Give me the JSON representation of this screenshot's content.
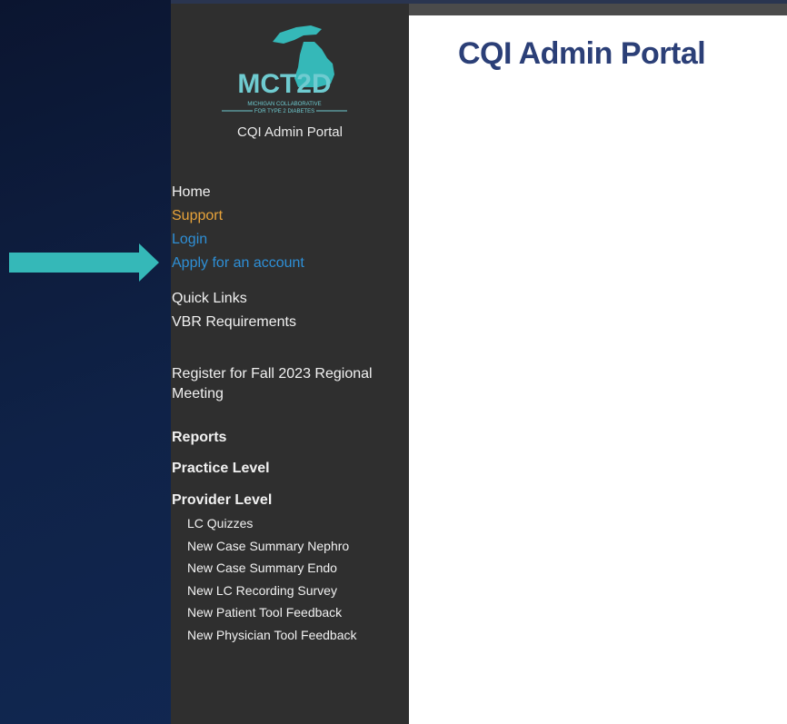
{
  "app": {
    "title": "CQI Admin Portal",
    "logo_text": "MCT2D",
    "logo_sub1": "MICHIGAN COLLABORATIVE",
    "logo_sub2": "FOR TYPE 2 DIABETES",
    "logo_caption": "CQI Admin Portal"
  },
  "nav": {
    "home": "Home",
    "support": "Support",
    "login": "Login",
    "apply": "Apply for an account",
    "quick_links": "Quick Links",
    "vbr": "VBR Requirements",
    "register_line1": "Register for Fall 2023 Regional",
    "register_line2": "Meeting",
    "reports": "Reports",
    "practice_level": "Practice Level",
    "provider_level": "Provider Level",
    "sub_items": [
      "LC Quizzes",
      "New Case Summary Nephro",
      "New Case Summary Endo",
      "New LC Recording Survey",
      "New Patient Tool Feedback",
      "New Physician Tool Feedback"
    ]
  },
  "colors": {
    "accent_teal": "#35b8b8",
    "title_blue": "#2b3f77",
    "link_blue": "#2e8fd6",
    "support_orange": "#e8a33a",
    "sidebar_bg": "#2f2f2f"
  },
  "icons": {
    "arrow": "right-arrow-icon",
    "logo": "michigan-map-logo"
  }
}
